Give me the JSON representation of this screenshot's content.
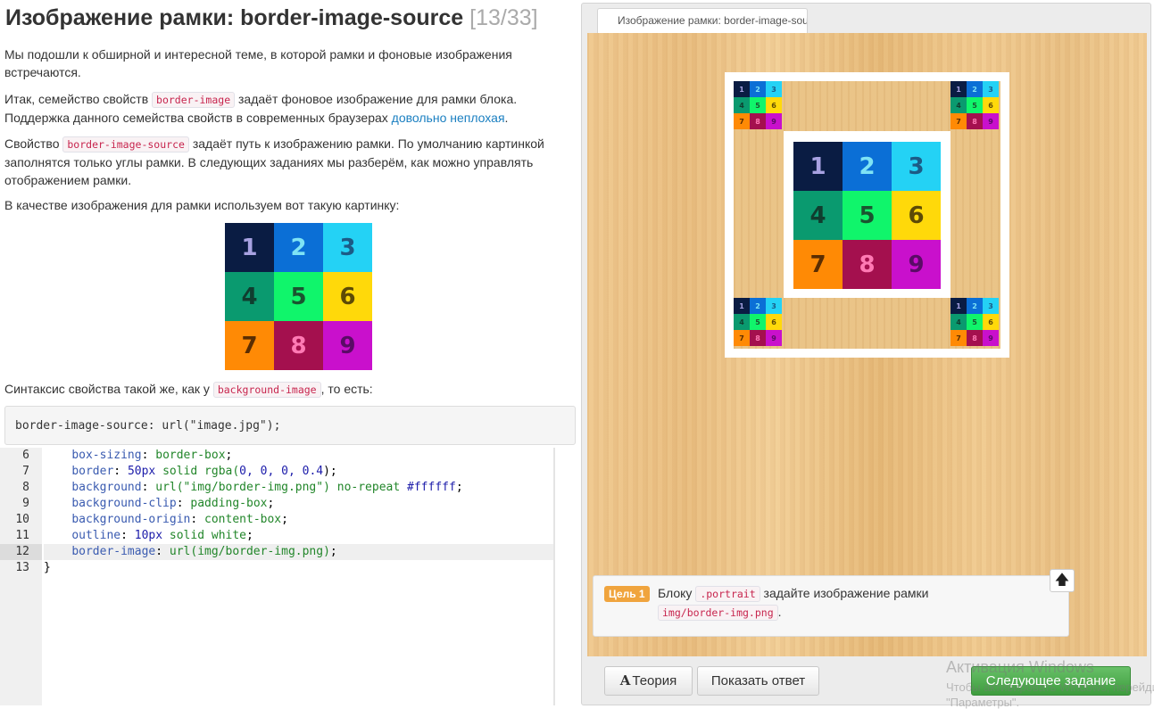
{
  "theory": {
    "title": "Изображение рамки: border-image-source",
    "counter": "[13/33]",
    "p1": "Мы подошли к обширной и интересной теме, в которой рамки и фоновые изображения встречаются.",
    "p2_a": "Итак, семейство свойств ",
    "p2_code": "border-image",
    "p2_b": " задаёт фоновое изображение для рамки блока. Поддержка данного семейства свойств в современных браузерах ",
    "p2_link": "довольно неплохая",
    "p2_c": ".",
    "p3_a": "Свойство ",
    "p3_code": "border-image-source",
    "p3_b": " задаёт путь к изображению рамки. По умолчанию картинкой заполнятся только углы рамки. В следующих заданиях мы разберём, как можно управлять отображением рамки.",
    "p4": "В качестве изображения для рамки используем вот такую картинку:",
    "p5_a": "Синтаксис свойства такой же, как у ",
    "p5_code": "background-image",
    "p5_b": ", то есть:",
    "example_code": "border-image-source: url(\"image.jpg\");"
  },
  "tiles": [
    "1",
    "2",
    "3",
    "4",
    "5",
    "6",
    "7",
    "8",
    "9"
  ],
  "tile_colors": [
    "#0a1c43",
    "#0b6fd6",
    "#24d2f5",
    "#0a9a6f",
    "#10f56b",
    "#ffd90a",
    "#ff8a05",
    "#a4104e",
    "#c910cc"
  ],
  "editor": {
    "line_numbers": [
      "6",
      "7",
      "8",
      "9",
      "10",
      "11",
      "12",
      "13"
    ],
    "active_line": "12",
    "lines": [
      {
        "prop": "box-sizing",
        "colon": ": ",
        "val": "border-box",
        "tail": ";"
      },
      {
        "prop": "border",
        "colon": ": ",
        "num": "50px",
        "val": " solid rgba(",
        "n2": "0, 0, 0, 0.4",
        "tail": ");"
      },
      {
        "prop": "background",
        "colon": ": ",
        "val": "url(\"img/border-img.png\") no-repeat ",
        "n2": "#ffffff",
        "tail": ";"
      },
      {
        "prop": "background-clip",
        "colon": ": ",
        "val": "padding-box",
        "tail": ";"
      },
      {
        "prop": "background-origin",
        "colon": ": ",
        "val": "content-box",
        "tail": ";"
      },
      {
        "prop": "outline",
        "colon": ": ",
        "num": "10px",
        "val": " solid white",
        "tail": ";"
      },
      {
        "prop": "border-image",
        "colon": ": ",
        "val": "url(img/border-img.png)",
        "tail": ";"
      },
      {
        "close": "}"
      }
    ]
  },
  "preview": {
    "tab_label": "Изображение рамки: border-image-source"
  },
  "goal": {
    "badge": "Цель 1",
    "text_a": "Блоку ",
    "code1": ".portrait",
    "text_b": " задайте изображение рамки",
    "code2": "img/border-img.png",
    "text_c": "."
  },
  "toolbar": {
    "theory_icon": "A",
    "theory_label": "Теория",
    "answer_label": "Показать ответ",
    "next_label": "Следующее задание",
    "scroll_up_icon": "arrow-up-icon"
  },
  "watermark": {
    "line1": "Активация Windows",
    "line2": "Чтобы активировать Windows, перейдите в",
    "line3": "\"Параметры\"."
  },
  "colors": {
    "accent_link": "#1a7fc1",
    "goal_badge": "#f0a43d",
    "next_button": "#4aa84a",
    "code_text": "#c7254e"
  }
}
